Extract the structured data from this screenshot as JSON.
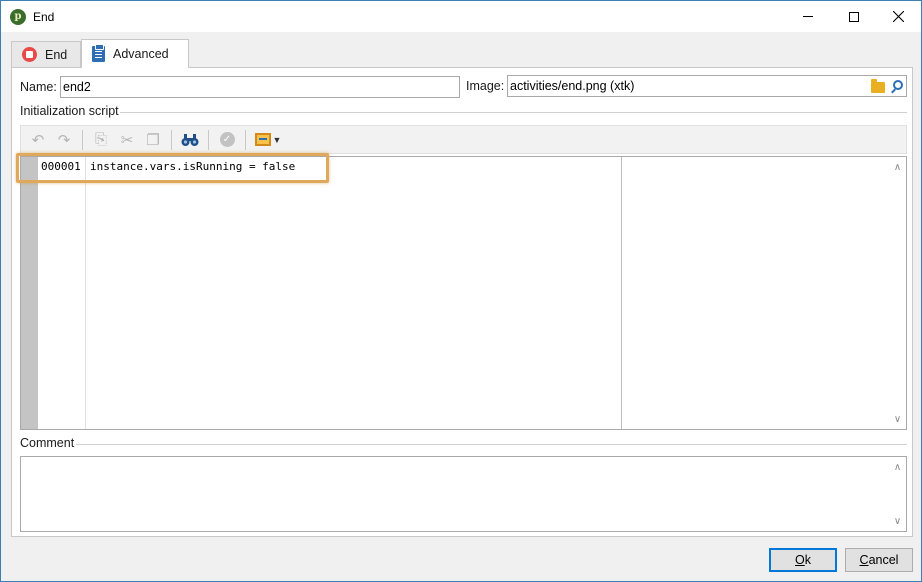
{
  "window": {
    "title": "End"
  },
  "tabs": [
    {
      "label": "End",
      "icon": "stop-icon"
    },
    {
      "label": "Advanced",
      "icon": "clipboard-icon",
      "selected": true
    }
  ],
  "form": {
    "name_label": "Name:",
    "name_value": "end2",
    "image_label": "Image:",
    "image_value": "activities/end.png (xtk)",
    "script_section": "Initialization script",
    "comment_section": "Comment",
    "comment_value": ""
  },
  "toolbar": {
    "items": [
      "undo-icon",
      "redo-icon",
      "copy-icon",
      "cut-icon",
      "paste-icon",
      "find-icon",
      "check-syntax-icon",
      "insert-field-icon"
    ]
  },
  "editor": {
    "lines": [
      {
        "number": "000001",
        "code": "instance.vars.isRunning = false"
      }
    ]
  },
  "buttons": {
    "ok_prefix": "",
    "ok_underlined": "O",
    "ok_rest": "k",
    "cancel_prefix": "",
    "cancel_underlined": "C",
    "cancel_rest": "ancel"
  },
  "colors": {
    "highlight_border": "#e0a85a",
    "primary_button_border": "#0078d7",
    "gutter": "#c4c4c4"
  }
}
